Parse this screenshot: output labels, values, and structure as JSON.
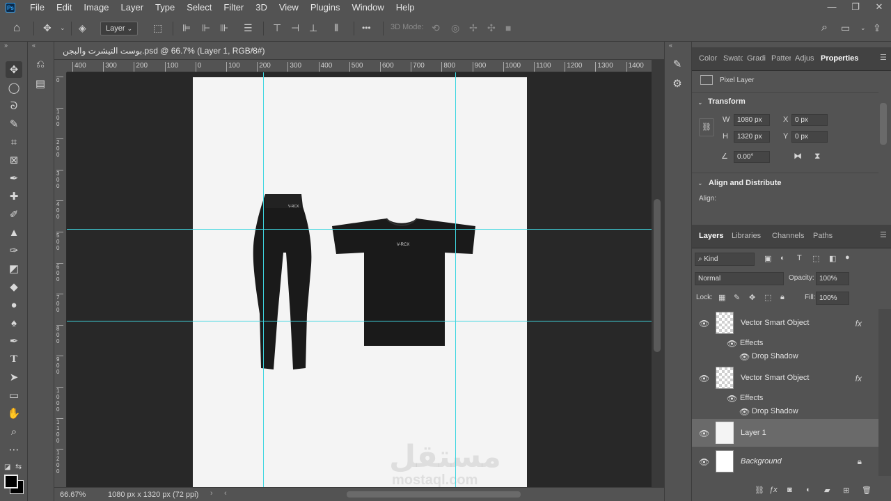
{
  "app": {
    "logo": "Ps",
    "menu": [
      "File",
      "Edit",
      "Image",
      "Layer",
      "Type",
      "Select",
      "Filter",
      "3D",
      "View",
      "Plugins",
      "Window",
      "Help"
    ]
  },
  "window_controls": {
    "minimize": "—",
    "restore": "❐",
    "close": "✕"
  },
  "options_bar": {
    "layer_dropdown": "Layer",
    "mode_3d": "3D Mode:",
    "more": "•••"
  },
  "document": {
    "tab_title": "بوست التيشرت والبجن.psd @ 66.7% (Layer 1, RGB/8#)",
    "close": "×",
    "ruler_h": [
      "400",
      "300",
      "200",
      "100",
      "0",
      "100",
      "200",
      "300",
      "400",
      "500",
      "600",
      "700",
      "800",
      "900",
      "1000",
      "1100",
      "1200",
      "1300",
      "1400"
    ],
    "ruler_v": [
      "0",
      "1 0 0",
      "2 0 0",
      "3 0 0",
      "4 0 0",
      "5 0 0",
      "6 0 0",
      "7 0 0",
      "8 0 0",
      "9 0 0",
      "1 0 0 0",
      "1 1 0 0",
      "1 2 0 0"
    ]
  },
  "status": {
    "zoom": "66.67%",
    "doc_info": "1080 px x 1320 px (72 ppi)"
  },
  "panel_tabs_top": [
    "Color",
    "Swatc",
    "Gradi",
    "Patter",
    "Adjus",
    "Properties"
  ],
  "properties": {
    "kind": "Pixel Layer",
    "transform_title": "Transform",
    "w_label": "W",
    "w": "1080 px",
    "h_label": "H",
    "h": "1320 px",
    "x_label": "X",
    "x": "0 px",
    "y_label": "Y",
    "y": "0 px",
    "angle": "0.00°",
    "align_title": "Align and Distribute",
    "align_label": "Align:"
  },
  "layers_panel": {
    "tabs": [
      "Layers",
      "Libraries",
      "Channels",
      "Paths"
    ],
    "kind_filter": "Kind",
    "blend_mode": "Normal",
    "opacity_label": "Opacity:",
    "opacity": "100%",
    "lock_label": "Lock:",
    "fill_label": "Fill:",
    "fill": "100%",
    "layers": [
      {
        "name": "Vector Smart Object",
        "fx": "fx",
        "effects": "Effects",
        "effect": "Drop Shadow"
      },
      {
        "name": "Vector Smart Object",
        "fx": "fx",
        "effects": "Effects",
        "effect": "Drop Shadow"
      },
      {
        "name": "Layer 1"
      },
      {
        "name": "Background"
      }
    ]
  },
  "artwork": {
    "brand": "V-RCX",
    "watermark_ar": "مستقل",
    "watermark_en": "mostaql.com"
  },
  "colors": {
    "canvas_bg": "#f4f4f4",
    "pasteboard": "#282828",
    "guide": "#3fd6e0",
    "garment": "#1a1a1a"
  }
}
